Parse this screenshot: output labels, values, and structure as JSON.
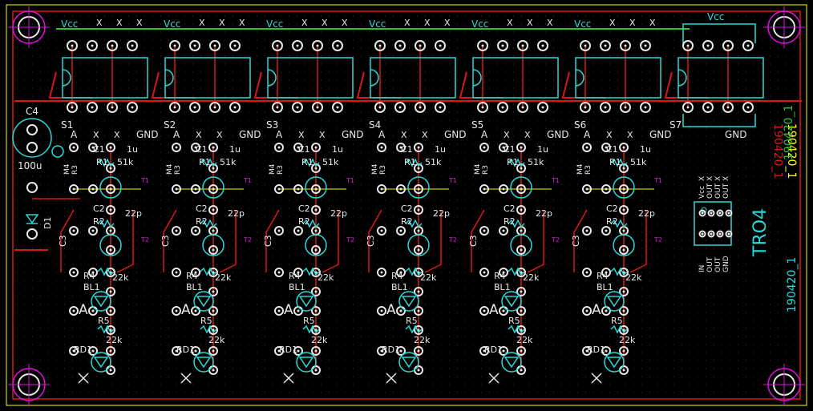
{
  "colors": {
    "background": "#000000",
    "grid": "#3a3a3a",
    "border": "#ffff00",
    "copper_red": "#d81818",
    "silk_cyan": "#2ad8d8",
    "silk_white": "#e8e8e8",
    "drill_white": "#ffffff",
    "mount_hole": "#e010e0",
    "jumper_green": "#30c030",
    "keepout_yellow": "#ffff00",
    "ref_magenta": "#d020d0"
  },
  "board": {
    "label_tro4": "TRO4",
    "label_rev_cyan": "190420_1",
    "label_rev_yellow": "190420_1",
    "label_rev_red": "190420_1",
    "label_rev_green": "190420_1"
  },
  "top_row": {
    "vcc": "Vcc",
    "x": "X"
  },
  "ic": {
    "vcc": "Vcc",
    "gnd": "GND"
  },
  "header": {
    "a": "A",
    "x": "X",
    "gnd": "GND"
  },
  "channels": [
    {
      "s": "S1"
    },
    {
      "s": "S2"
    },
    {
      "s": "S3"
    },
    {
      "s": "S4"
    },
    {
      "s": "S5"
    },
    {
      "s": "S6"
    }
  ],
  "last_header": "S7",
  "cap_c4": {
    "ref": "C4",
    "value": "100u"
  },
  "diode_d1": "D1",
  "parts": {
    "c1": "C1",
    "c1_val": "1u",
    "r1": "R1",
    "r1_val": "51k",
    "r3": "R3",
    "m_jump": "M4",
    "c2": "C2",
    "c2_val": "22p",
    "r2": "R2",
    "c3": "C3",
    "r4": "R4",
    "r4_val": "22k",
    "bl": "BL1",
    "r5": "R5",
    "r5_val": "22k",
    "rd": "RD1",
    "t1": "T1",
    "t2": "T2",
    "led_a": "A"
  },
  "dip8_labels": {
    "left": [
      "Vcc",
      "OUT",
      "OUT",
      "OUT"
    ],
    "right": [
      "X",
      "X",
      "X",
      "X"
    ],
    "bottom": [
      "IN",
      "OUT",
      "OUT",
      "GND"
    ]
  }
}
